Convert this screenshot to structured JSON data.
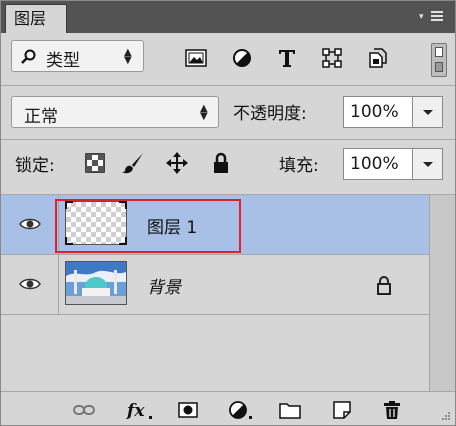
{
  "panel": {
    "tab_label": "图层"
  },
  "filter": {
    "kind_label": "类型",
    "icons": [
      "image-filter-icon",
      "adjustment-filter-icon",
      "type-filter-icon",
      "shape-filter-icon",
      "smart-object-filter-icon"
    ]
  },
  "blend": {
    "mode": "正常",
    "opacity_label": "不透明度:",
    "opacity_value": "100%"
  },
  "lock": {
    "label": "锁定:",
    "fill_label": "填充:",
    "fill_value": "100%"
  },
  "layers": [
    {
      "name": "图层 1",
      "selected": true,
      "visible": true,
      "locked": false,
      "thumbnail": "transparent"
    },
    {
      "name": "背景",
      "selected": false,
      "visible": true,
      "locked": true,
      "thumbnail": "photo"
    }
  ],
  "colors": {
    "panel_bg": "#d6d6d6",
    "selected_row": "#a8bfe6",
    "highlight_box": "#e0202a",
    "titlebar": "#535353"
  },
  "bottom_icons": [
    "link-layers-icon",
    "fx-icon",
    "mask-icon",
    "adjustment-layer-icon",
    "group-folder-icon",
    "new-layer-icon",
    "trash-icon"
  ]
}
